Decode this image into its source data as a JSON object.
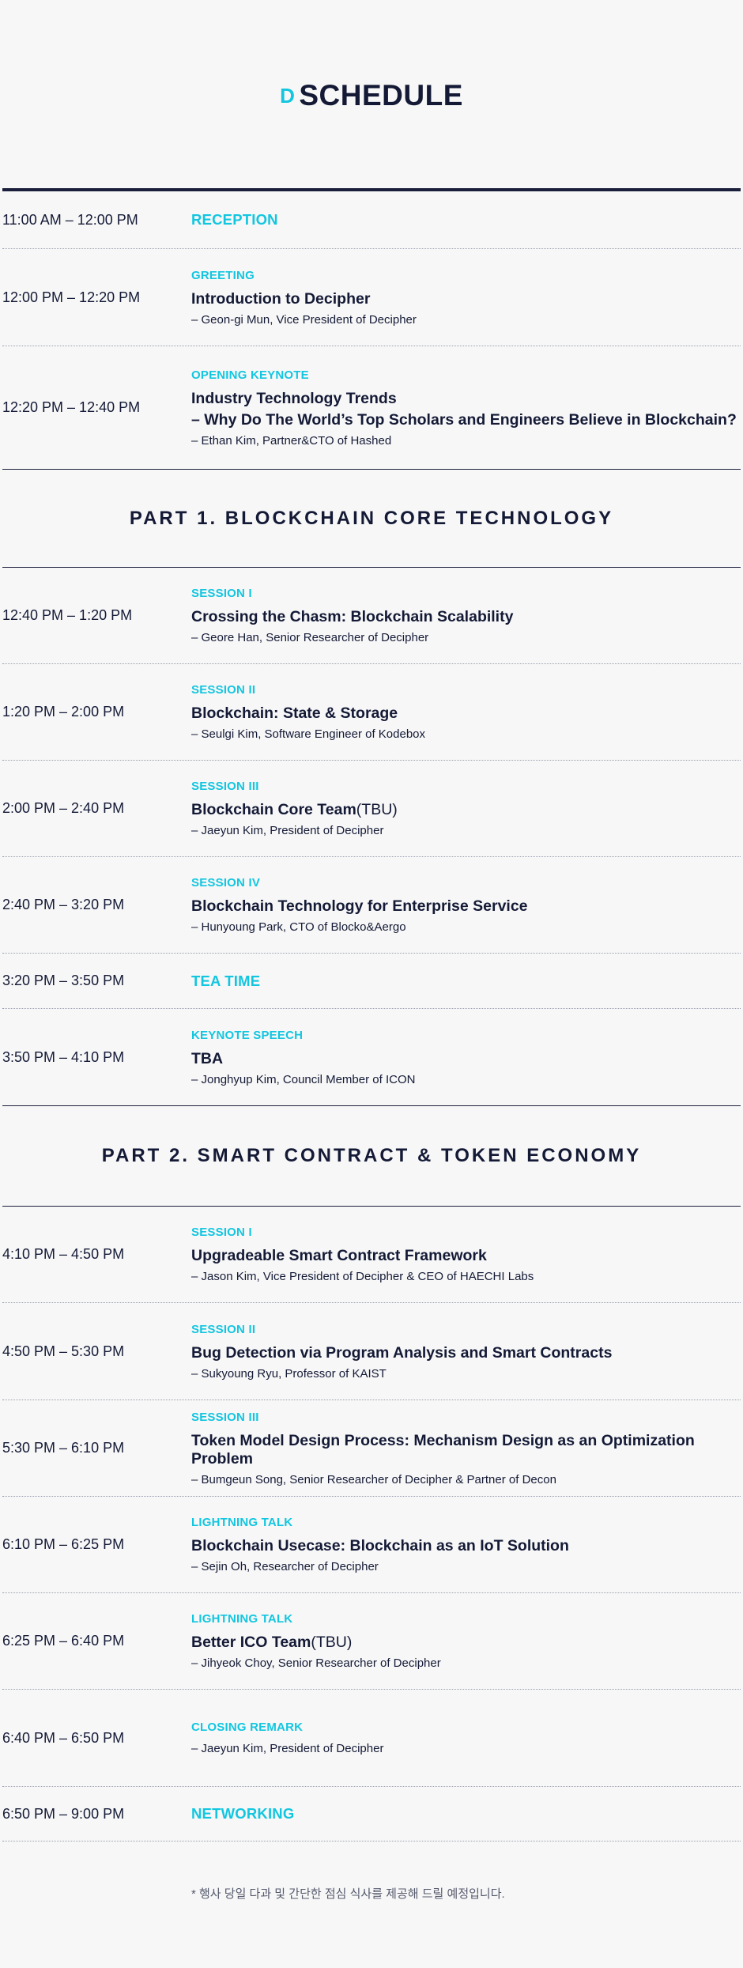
{
  "header": {
    "logo_letter": "D",
    "title": "SCHEDULE"
  },
  "block_intro": [
    {
      "time": "11:00 AM – 12:00 PM",
      "label": "RECEPTION",
      "big_label": true
    },
    {
      "time": "12:00 PM – 12:20 PM",
      "label": "GREETING",
      "title": "Introduction to Decipher",
      "speaker": "– Geon-gi Mun, Vice President of Decipher"
    },
    {
      "time": "12:20 PM – 12:40 PM",
      "label": "OPENING KEYNOTE",
      "title": "Industry Technology Trends",
      "subtitle": "– Why Do The World’s Top Scholars and Engineers Believe in Blockchain?",
      "speaker": "– Ethan Kim, Partner&CTO of Hashed"
    }
  ],
  "part1": {
    "title": "PART 1. BLOCKCHAIN CORE TECHNOLOGY",
    "rows": [
      {
        "time": "12:40 PM – 1:20 PM",
        "label": "SESSION  I",
        "title": "Crossing the Chasm: Blockchain Scalability",
        "speaker": "– Geore Han, Senior Researcher of Decipher"
      },
      {
        "time": "1:20 PM – 2:00 PM",
        "label": "SESSION  II",
        "title": "Blockchain: State & Storage",
        "speaker": "– Seulgi Kim, Software Engineer of Kodebox"
      },
      {
        "time": "2:00 PM – 2:40 PM",
        "label": "SESSION  III",
        "title": "Blockchain Core Team",
        "tbu": "(TBU)",
        "speaker": "– Jaeyun Kim, President of Decipher"
      },
      {
        "time": "2:40 PM – 3:20 PM",
        "label": "SESSION  IV",
        "title": "Blockchain Technology for Enterprise Service",
        "speaker": "– Hunyoung Park, CTO of Blocko&Aergo"
      },
      {
        "time": "3:20 PM – 3:50 PM",
        "label": "TEA TIME",
        "big_label": true
      },
      {
        "time": "3:50 PM – 4:10 PM",
        "label": "KEYNOTE SPEECH",
        "title": "TBA",
        "speaker": "– Jonghyup Kim, Council Member of ICON"
      }
    ]
  },
  "part2": {
    "title": "PART 2. SMART CONTRACT & TOKEN ECONOMY",
    "rows": [
      {
        "time": "4:10 PM – 4:50 PM",
        "label": "SESSION  I",
        "title": "Upgradeable Smart Contract Framework",
        "speaker": "– Jason Kim, Vice President of Decipher & CEO of HAECHI Labs"
      },
      {
        "time": "4:50 PM – 5:30 PM",
        "label": "SESSION  II",
        "title": "Bug Detection via Program Analysis and Smart Contracts",
        "speaker": "– Sukyoung Ryu, Professor of KAIST"
      },
      {
        "time": "5:30 PM – 6:10 PM",
        "label": "SESSION  III",
        "title": "Token Model Design Process: Mechanism Design as an Optimization Problem",
        "speaker": "– Bumgeun Song, Senior Researcher of Decipher & Partner of Decon"
      },
      {
        "time": "6:10 PM – 6:25 PM",
        "label": "LIGHTNING TALK",
        "title": "Blockchain Usecase: Blockchain as an IoT Solution",
        "speaker": "–  Sejin Oh, Researcher of Decipher"
      },
      {
        "time": "6:25 PM – 6:40 PM",
        "label": "LIGHTNING TALK",
        "title": "Better ICO Team",
        "tbu": "(TBU)",
        "speaker": "– Jihyeok Choy, Senior Researcher of Decipher"
      },
      {
        "time": "6:40 PM – 6:50 PM",
        "label": "CLOSING REMARK",
        "speaker": "– Jaeyun Kim, President of Decipher"
      },
      {
        "time": "6:50 PM – 9:00 PM",
        "label": "NETWORKING",
        "big_label": true
      }
    ]
  },
  "footnote": "* 행사 당일 다과 및 간단한 점심 식사를 제공해 드릴 예정입니다."
}
